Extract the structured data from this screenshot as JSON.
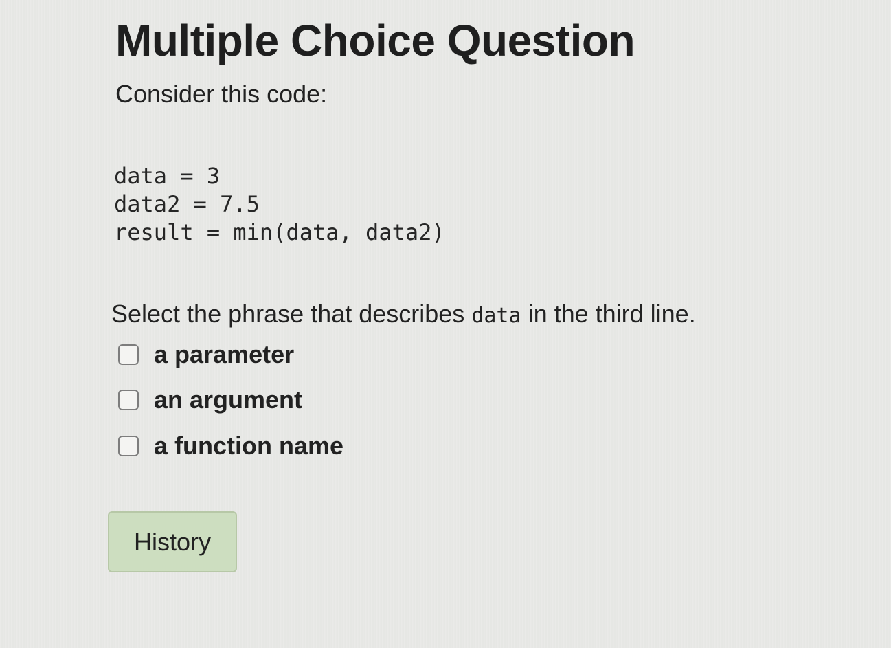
{
  "question": {
    "title": "Multiple Choice Question",
    "intro": "Consider this code:",
    "code_lines": [
      "data = 3",
      "data2 = 7.5",
      "result = min(data, data2)"
    ],
    "prompt_before": "Select the phrase that describes ",
    "prompt_code": "data",
    "prompt_after": " in the third line."
  },
  "options": [
    {
      "label": "a parameter",
      "checked": false
    },
    {
      "label": "an argument",
      "checked": false
    },
    {
      "label": "a function name",
      "checked": false
    }
  ],
  "actions": {
    "history_label": "History"
  },
  "colors": {
    "background": "#e6e7e4",
    "button": "#cddec0",
    "checkbox_border": "#7d7d7d"
  }
}
